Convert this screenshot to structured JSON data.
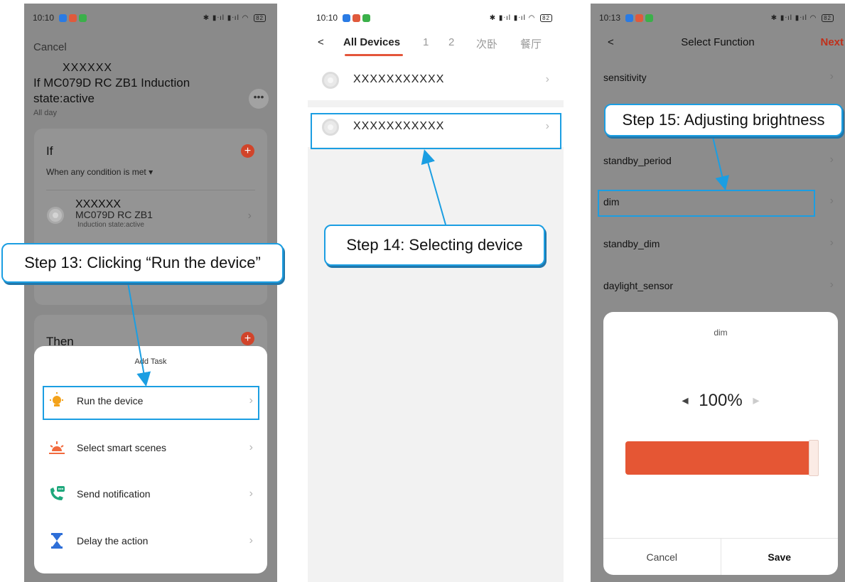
{
  "colors": {
    "accent": "#e4553a",
    "highlight": "#1b9ee2",
    "slider_fill": "#e55634",
    "next": "#c0301b"
  },
  "screen1": {
    "status_time": "10:10",
    "cancel": "Cancel",
    "masked_name": "XXXXXX",
    "title": "If MC079D RC ZB1 Induction state:active",
    "subtitle": "All day",
    "more": "•••",
    "if_card": {
      "title": "If",
      "condition_mode": "When any condition is met",
      "device_mask": "XXXXXX",
      "device_name": "MC079D RC ZB1",
      "device_state": "Induction state:active"
    },
    "then_card": {
      "title": "Then"
    },
    "sheet": {
      "title": "Add Task",
      "items": [
        {
          "label": "Run the device",
          "icon": "bulb-icon"
        },
        {
          "label": "Select smart scenes",
          "icon": "sunrise-icon"
        },
        {
          "label": "Send notification",
          "icon": "phone-message-icon"
        },
        {
          "label": "Delay the action",
          "icon": "hourglass-icon"
        }
      ]
    },
    "callout": "Step 13: Clicking “Run the device”"
  },
  "screen2": {
    "status_time": "10:10",
    "back": "<",
    "tabs": [
      "All Devices",
      "1",
      "2",
      "次卧",
      "餐厅"
    ],
    "devices": [
      {
        "name": "XXXXXXXXXXX"
      },
      {
        "name": "XXXXXXXXXXX"
      }
    ],
    "callout": "Step 14: Selecting device"
  },
  "screen3": {
    "status_time": "10:13",
    "back": "<",
    "title": "Select Function",
    "next": "Next",
    "functions": [
      {
        "label": "sensitivity"
      },
      {
        "label": "standby_period"
      },
      {
        "label": "dim"
      },
      {
        "label": "standby_dim"
      },
      {
        "label": "daylight_sensor"
      }
    ],
    "modal": {
      "title": "dim",
      "value_text": "100%",
      "value": 100,
      "cancel": "Cancel",
      "save": "Save"
    },
    "callout": "Step 15: Adjusting brightness"
  },
  "status_battery": "82"
}
